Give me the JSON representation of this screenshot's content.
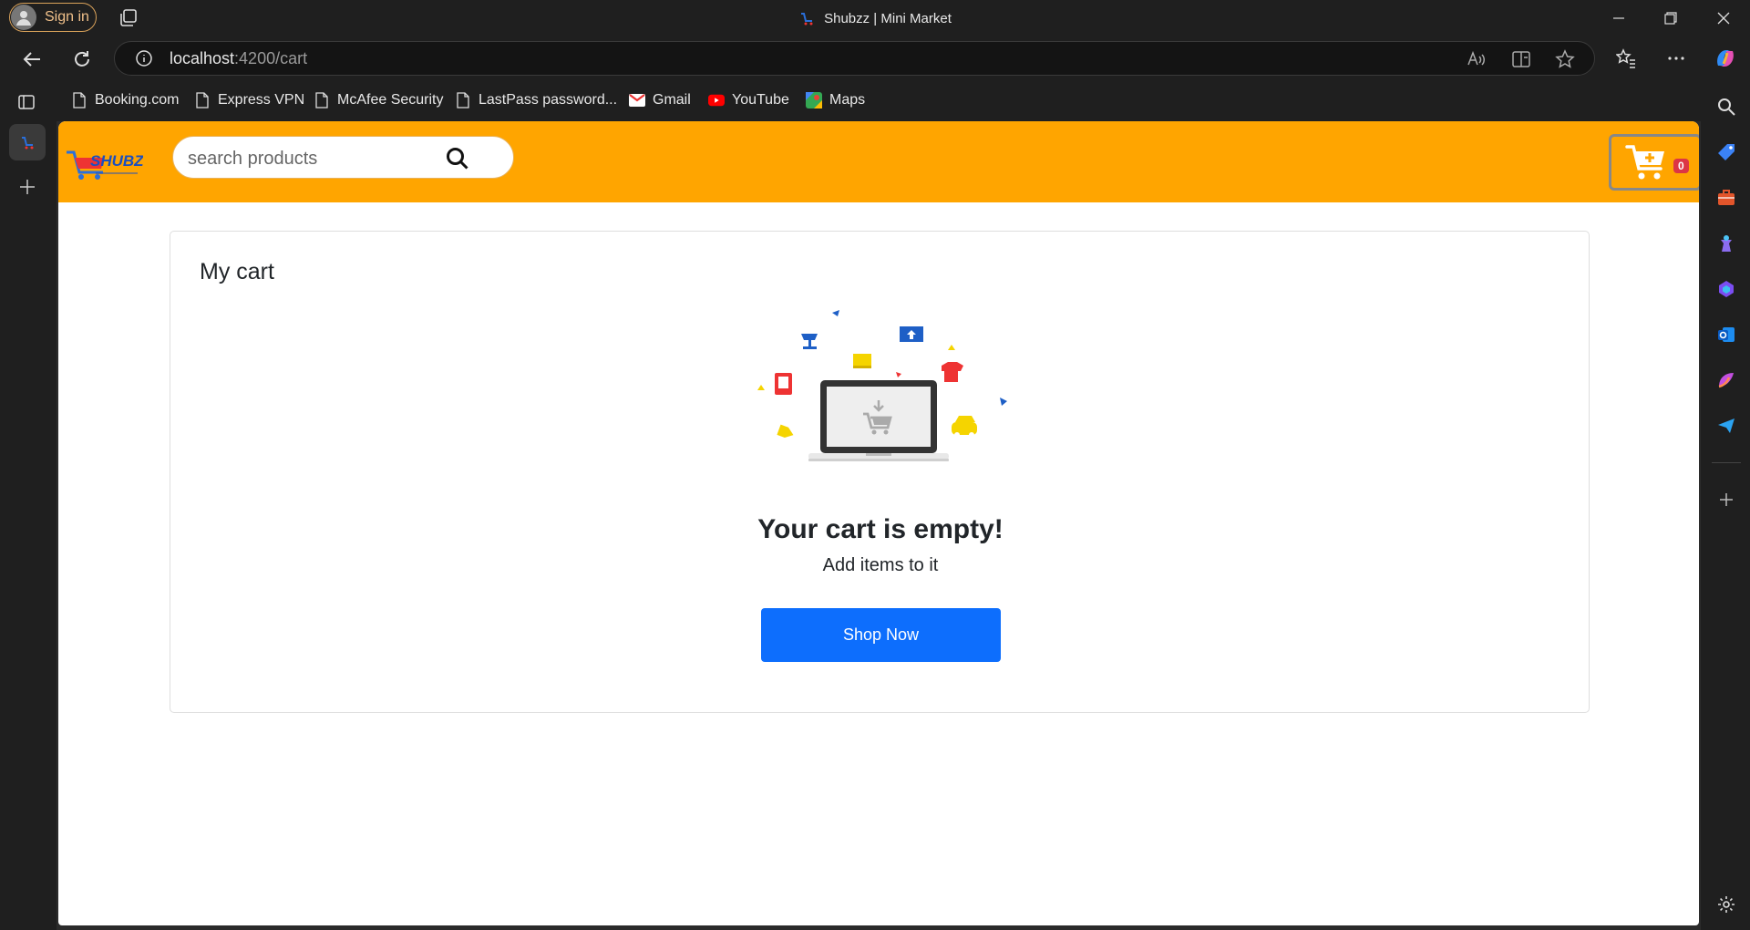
{
  "browser": {
    "signin_label": "Sign in",
    "window_title": "Shubzz | Mini Market",
    "url_host": "localhost",
    "url_path": ":4200/cart",
    "bookmarks": [
      {
        "label": "Booking.com",
        "icon": "page-icon"
      },
      {
        "label": "Express VPN",
        "icon": "page-icon"
      },
      {
        "label": "McAfee Security",
        "icon": "page-icon"
      },
      {
        "label": "LastPass password...",
        "icon": "page-icon"
      },
      {
        "label": "Gmail",
        "icon": "gmail-icon"
      },
      {
        "label": "YouTube",
        "icon": "youtube-icon"
      },
      {
        "label": "Maps",
        "icon": "maps-icon"
      }
    ]
  },
  "header": {
    "logo_text": "SHUBZZ",
    "search_placeholder": "search products",
    "cart_count": "0",
    "accent_color": "#ffa500"
  },
  "cart": {
    "title": "My cart",
    "empty_title": "Your cart is empty!",
    "empty_subtitle": "Add items to it",
    "shop_button": "Shop Now",
    "button_color": "#0d6efd"
  }
}
